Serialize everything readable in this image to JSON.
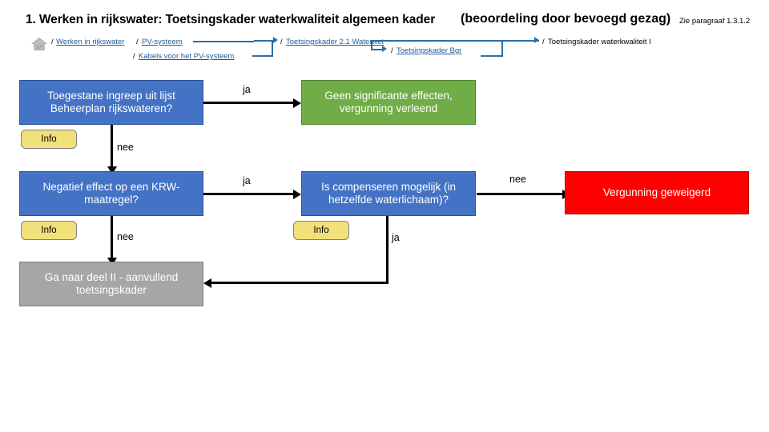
{
  "title": {
    "main": "1. Werken in rijkswater: Toetsingskader waterkwaliteit algemeen kader",
    "suffix": "(beoordeling door bevoegd gezag)",
    "note": "Zie paragraaf 1.3.1.2"
  },
  "breadcrumb": {
    "home_icon": "home-icon",
    "items": [
      {
        "sep": "/",
        "label": "Werken in rijkswater",
        "link": true
      },
      {
        "sep": "/",
        "label": "PV-systeem",
        "link": true
      },
      {
        "sep": "/",
        "label": "Kabels voor het PV-systeem",
        "link": true
      },
      {
        "sep": "/",
        "label": "Toetsingskader 2.1 Waterwet",
        "link": true
      },
      {
        "sep": "/",
        "label": "Toetsingskader Bgr",
        "link": true
      },
      {
        "sep": "/",
        "label": "Toetsingskader waterkwaliteit I",
        "link": false
      }
    ]
  },
  "flow": {
    "nodes": [
      {
        "id": "q1",
        "label": "Toegestane ingreep uit lijst Beheerplan rijkswateren?",
        "color": "#4472C4"
      },
      {
        "id": "r1",
        "label": "Geen significante effecten, vergunning verleend",
        "color": "#70AD47"
      },
      {
        "id": "q2",
        "label": "Negatief effect op een KRW-maatregel?",
        "color": "#4472C4"
      },
      {
        "id": "q3",
        "label": "Is compenseren mogelijk (in hetzelfde waterlichaam)?",
        "color": "#4472C4"
      },
      {
        "id": "r2",
        "label": "Vergunning geweigerd",
        "color": "#FF0000"
      },
      {
        "id": "r3",
        "label": "Ga naar deel II - aanvullend toetsingskader",
        "color": "#A6A6A6"
      }
    ],
    "info_buttons": [
      {
        "id": "info1",
        "label": "Info"
      },
      {
        "id": "info2",
        "label": "Info"
      },
      {
        "id": "info3",
        "label": "Info"
      }
    ],
    "edge_labels": {
      "q1_yes": "ja",
      "q1_no": "nee",
      "q2_yes": "ja",
      "q2_no": "nee",
      "q3_no": "nee",
      "q3_yes": "ja"
    }
  }
}
